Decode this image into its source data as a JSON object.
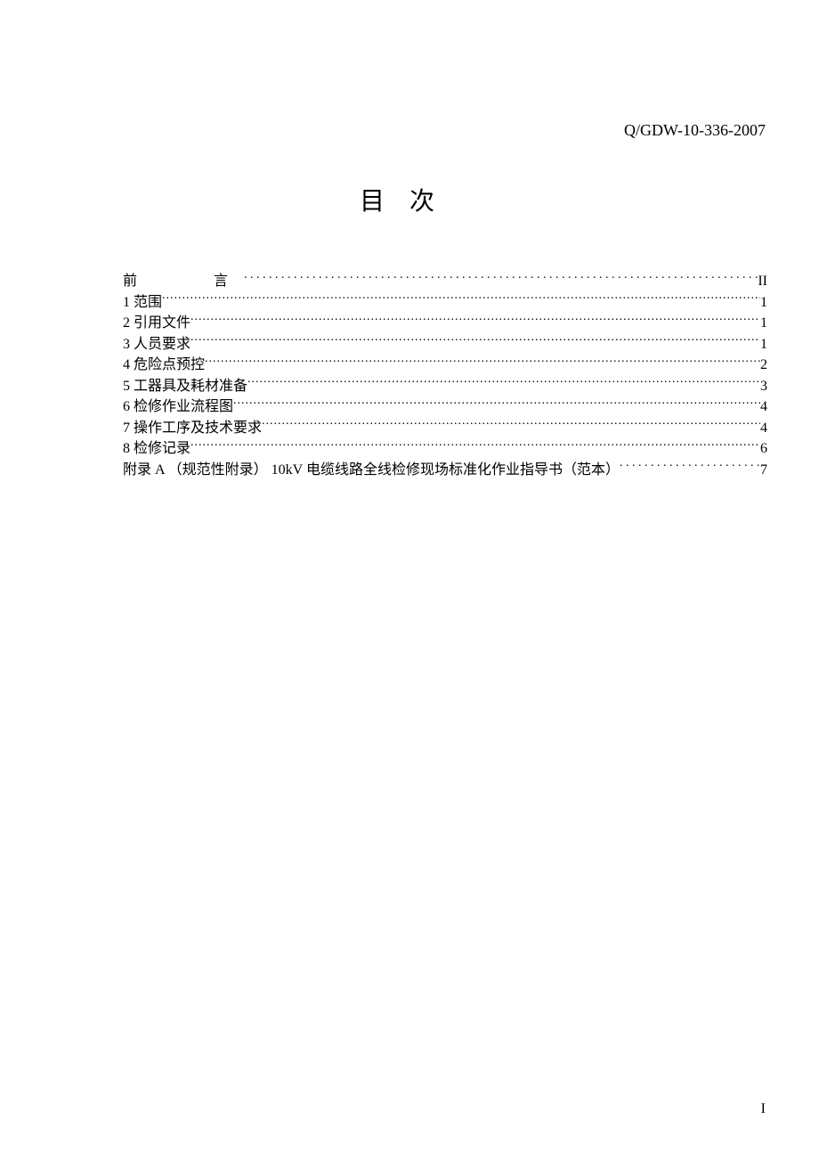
{
  "header_code": "Q/GDW-10-336-2007",
  "title": "目次",
  "toc": [
    {
      "label": "前  言",
      "page": "II",
      "sparse": true,
      "preface": true
    },
    {
      "label": "1  范围",
      "page": "1",
      "sparse": false
    },
    {
      "label": "2  引用文件",
      "page": "1",
      "sparse": false
    },
    {
      "label": "3  人员要求",
      "page": "1",
      "sparse": false
    },
    {
      "label": "4  危险点预控",
      "page": "2",
      "sparse": false
    },
    {
      "label": "5  工器具及耗材准备",
      "page": "3",
      "sparse": false
    },
    {
      "label": "6  检修作业流程图",
      "page": "4",
      "sparse": false
    },
    {
      "label": "7  操作工序及技术要求",
      "page": "4",
      "sparse": false
    },
    {
      "label": "8  检修记录",
      "page": "6",
      "sparse": false
    },
    {
      "label": "附录 A  （规范性附录）  10kV 电缆线路全线检修现场标准化作业指导书（范本）",
      "page": "7",
      "sparse": true
    }
  ],
  "page_number": "I"
}
